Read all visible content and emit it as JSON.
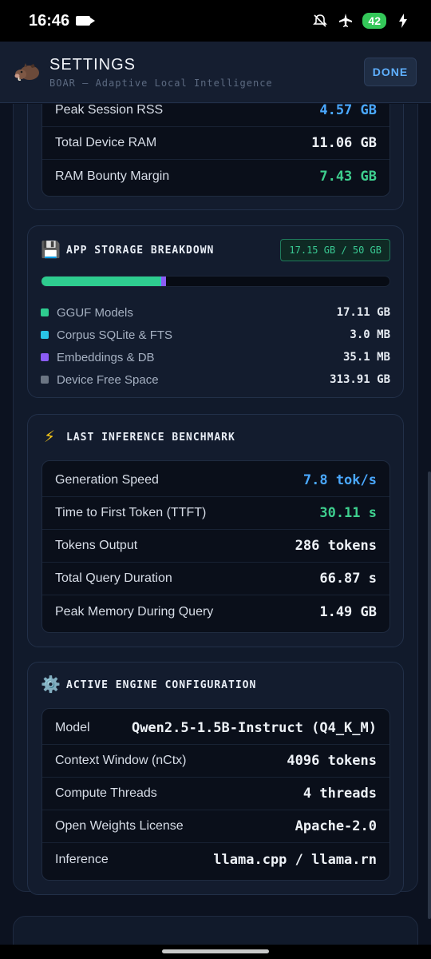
{
  "status_bar": {
    "time": "16:46",
    "battery": "42",
    "icons": [
      "video-camera-icon",
      "mute-icon",
      "airplane-mode-icon",
      "charging-icon"
    ]
  },
  "header": {
    "title": "SETTINGS",
    "subtitle": "BOAR — Adaptive Local Intelligence",
    "done_label": "DONE",
    "logo_icon": "boar-icon"
  },
  "memory": {
    "rows": [
      {
        "label": "Peak Session RSS",
        "value": "4.57 GB",
        "color": "#4aa8ff"
      },
      {
        "label": "Total Device RAM",
        "value": "11.06 GB",
        "color": "#eef2f7"
      },
      {
        "label": "RAM Bounty Margin",
        "value": "7.43 GB",
        "color": "#3ecf8e"
      }
    ]
  },
  "storage": {
    "icon": "floppy-disk-icon",
    "icon_glyph": "💾",
    "title": "APP STORAGE BREAKDOWN",
    "badge": "17.15 GB / 50 GB",
    "bar_fractions": {
      "gguf": 0.342,
      "corpus": 0.001,
      "embeddings": 0.012
    },
    "legend": [
      {
        "label": "GGUF Models",
        "value": "17.11 GB",
        "color": "#2ecc8f"
      },
      {
        "label": "Corpus SQLite & FTS",
        "value": "3.0 MB",
        "color": "#29c4e6"
      },
      {
        "label": "Embeddings & DB",
        "value": "35.1 MB",
        "color": "#8b5cf6"
      },
      {
        "label": "Device Free Space",
        "value": "313.91 GB",
        "color": "#6b7583"
      }
    ]
  },
  "benchmark": {
    "icon": "lightning-icon",
    "icon_glyph": "⚡",
    "title": "LAST INFERENCE BENCHMARK",
    "rows": [
      {
        "label": "Generation Speed",
        "value": "7.8 tok/s"
      },
      {
        "label": "Time to First Token (TTFT)",
        "value": "30.11 s"
      },
      {
        "label": "Tokens Output",
        "value": "286 tokens"
      },
      {
        "label": "Total Query Duration",
        "value": "66.87 s"
      },
      {
        "label": "Peak Memory During Query",
        "value": "1.49 GB"
      }
    ]
  },
  "engine": {
    "icon": "gear-icon",
    "icon_glyph": "⚙️",
    "title": "ACTIVE ENGINE CONFIGURATION",
    "rows": [
      {
        "label": "Model",
        "value": "Qwen2.5-1.5B-Instruct (Q4_K_M)"
      },
      {
        "label": "Context Window (nCtx)",
        "value": "4096 tokens"
      },
      {
        "label": "Compute Threads",
        "value": "4 threads"
      },
      {
        "label": "Open Weights License",
        "value": "Apache-2.0"
      },
      {
        "label": "Inference",
        "value": "llama.cpp / llama.rn"
      }
    ]
  }
}
